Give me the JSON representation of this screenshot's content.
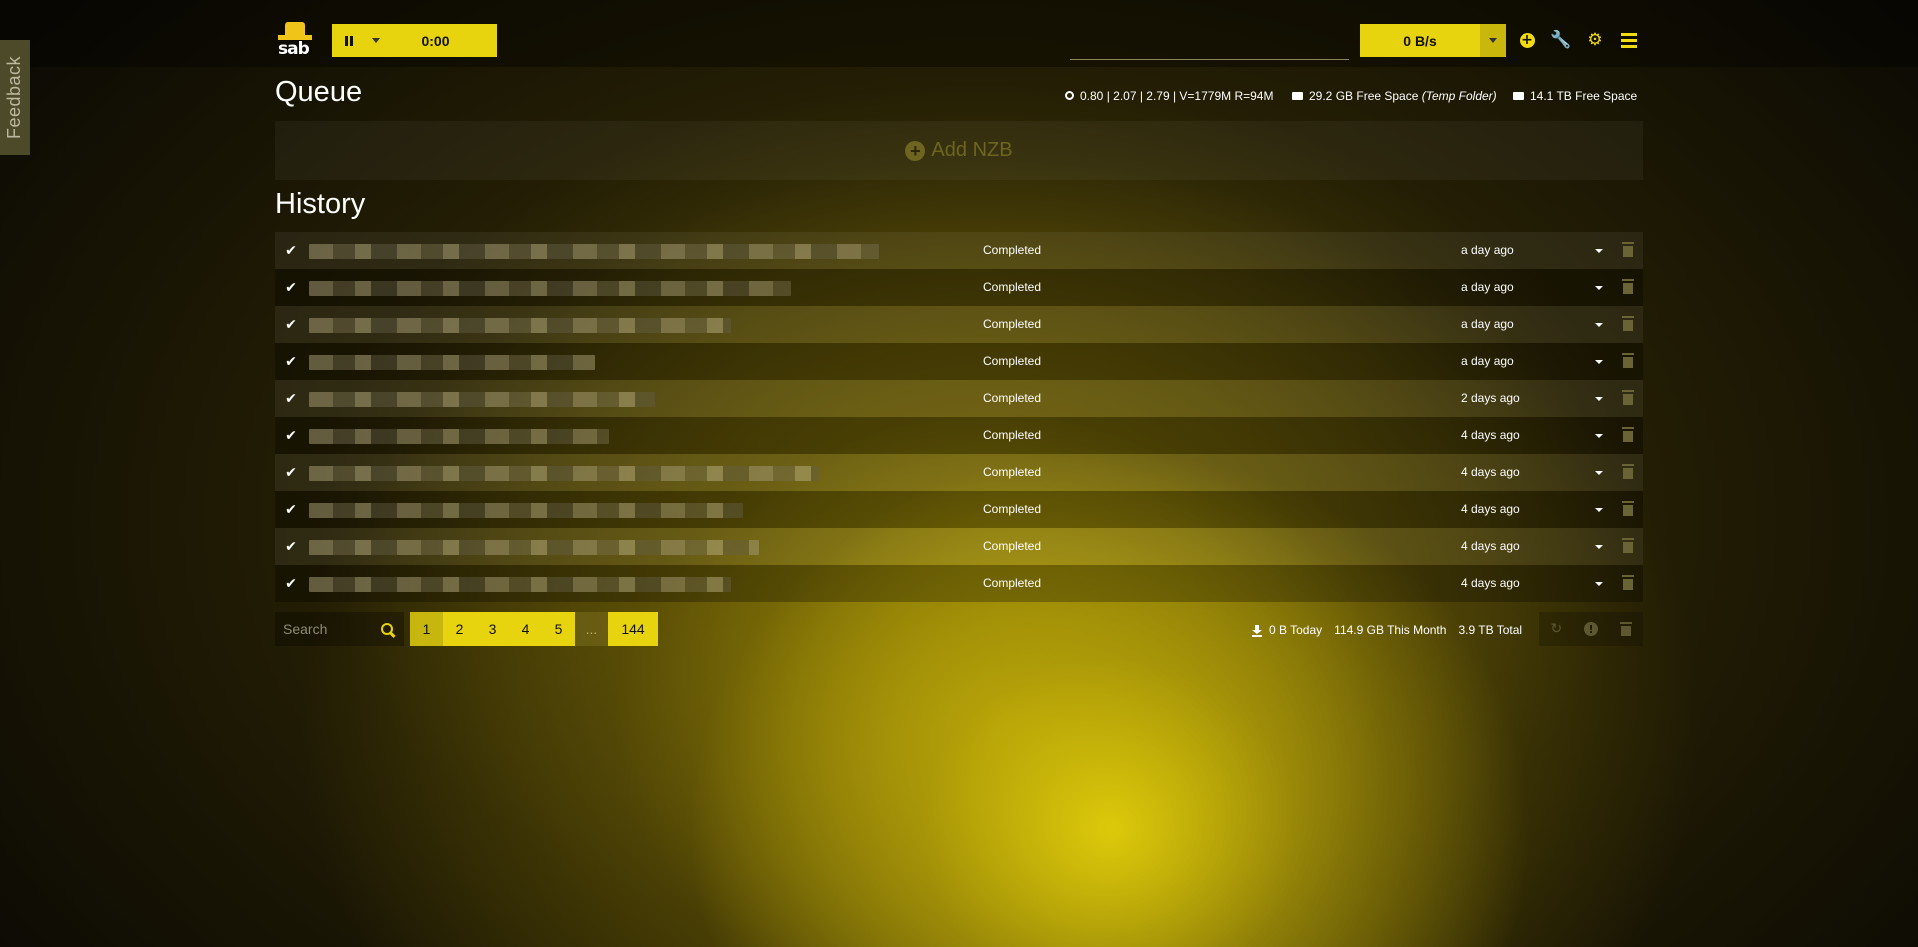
{
  "feedback": {
    "label": "Feedback"
  },
  "logo": {
    "text": "sab"
  },
  "toolbar": {
    "timer": "0:00",
    "speed": "0 B/s",
    "search_placeholder": ""
  },
  "queue": {
    "title": "Queue",
    "load_stats": "0.80 | 2.07 | 2.79 | V=1779M R=94M",
    "temp_space": "29.2 GB Free Space",
    "temp_label": "(Temp Folder)",
    "complete_space": "14.1 TB Free Space",
    "add_nzb": "Add NZB"
  },
  "history": {
    "title": "History",
    "rows": [
      {
        "status": "Completed",
        "time": "a day ago"
      },
      {
        "status": "Completed",
        "time": "a day ago"
      },
      {
        "status": "Completed",
        "time": "a day ago"
      },
      {
        "status": "Completed",
        "time": "a day ago"
      },
      {
        "status": "Completed",
        "time": "2 days ago"
      },
      {
        "status": "Completed",
        "time": "4 days ago"
      },
      {
        "status": "Completed",
        "time": "4 days ago"
      },
      {
        "status": "Completed",
        "time": "4 days ago"
      },
      {
        "status": "Completed",
        "time": "4 days ago"
      },
      {
        "status": "Completed",
        "time": "4 days ago"
      }
    ]
  },
  "footer": {
    "search_placeholder": "Search",
    "pages": [
      "1",
      "2",
      "3",
      "4",
      "5",
      "...",
      "144"
    ],
    "today": "0 B Today",
    "month": "114.9 GB This Month",
    "total": "3.9 TB Total"
  },
  "colors": {
    "accent": "#e8d40e",
    "text": "#ffffff",
    "muted_icon": "#6a6335"
  },
  "icons": {
    "pause": "pause-icon",
    "add": "plus-circle-icon",
    "wrench": "wrench-icon",
    "settings": "gear-icon",
    "menu": "hamburger-icon",
    "check": "check-icon",
    "trash": "trash-icon",
    "search": "search-icon",
    "download": "download-icon",
    "refresh": "refresh-icon",
    "alert": "exclamation-circle-icon"
  }
}
